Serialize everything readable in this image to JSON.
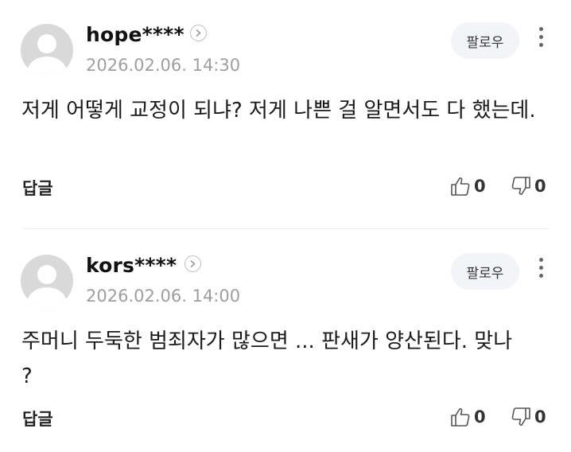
{
  "comments": [
    {
      "username": "hope****",
      "date": "2026.02.06. 14:30",
      "follow_label": "팔로우",
      "text": "저게 어떻게 교정이 되냐? 저게 나쁜 걸 알면서도 다 했는데.",
      "reply_label": "답글",
      "likes": "0",
      "dislikes": "0"
    },
    {
      "username": "kors****",
      "date": "2026.02.06. 14:00",
      "follow_label": "팔로우",
      "text": "주머니 두둑한 범죄자가 많으면 ... 판새가 양산된다. 맞나 ?",
      "reply_label": "답글",
      "likes": "0",
      "dislikes": "0"
    }
  ],
  "icons": {
    "avatar": "default-user-avatar",
    "chevron": "chevron-right-icon",
    "more": "more-vertical-icon",
    "like": "thumbs-up-icon",
    "dislike": "thumbs-down-icon"
  },
  "colors": {
    "avatar_bg": "#d9d9d9",
    "date": "#9e9e9e",
    "follow_bg": "#f3f4f7"
  }
}
